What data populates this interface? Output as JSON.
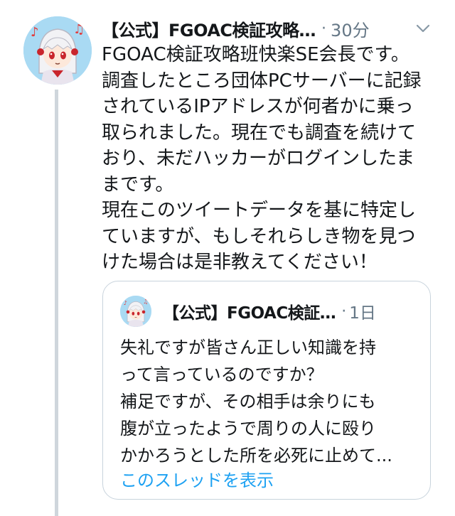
{
  "tweet": {
    "author": "【公式】FGOAC検証攻略…",
    "separator": "·",
    "time": "30分",
    "lines": [
      "FGOAC検証攻略班快楽SE会長です。",
      "調査したところ団体PCサーバーに記録",
      "されているIPアドレスが何者かに乗っ",
      "取られました。現在でも調査を続けて",
      "おり、未だハッカーがログインしたま",
      "まです。",
      "現在このツイートデータを基に特定し",
      "ていますが、もしそれらしき物を見つ",
      "けた場合は是非教えてください！"
    ]
  },
  "quote": {
    "author": "【公式】FGOAC検証…",
    "separator": "·",
    "time": "1日",
    "lines": [
      "失礼ですが皆さん正しい知識を持",
      "って言っているのですか？",
      "補足ですが、その相手は余りにも",
      "腹が立ったようで周りの人に殴り",
      "かかろうとした所を必死に止めて..."
    ],
    "show_thread": "このスレッドを表示"
  },
  "icons": {
    "menu": "chevron-down-icon",
    "avatar": "avatar-image"
  },
  "colors": {
    "link": "#1da1f2",
    "meta": "#657786",
    "thread_line": "#cfd6dc"
  }
}
